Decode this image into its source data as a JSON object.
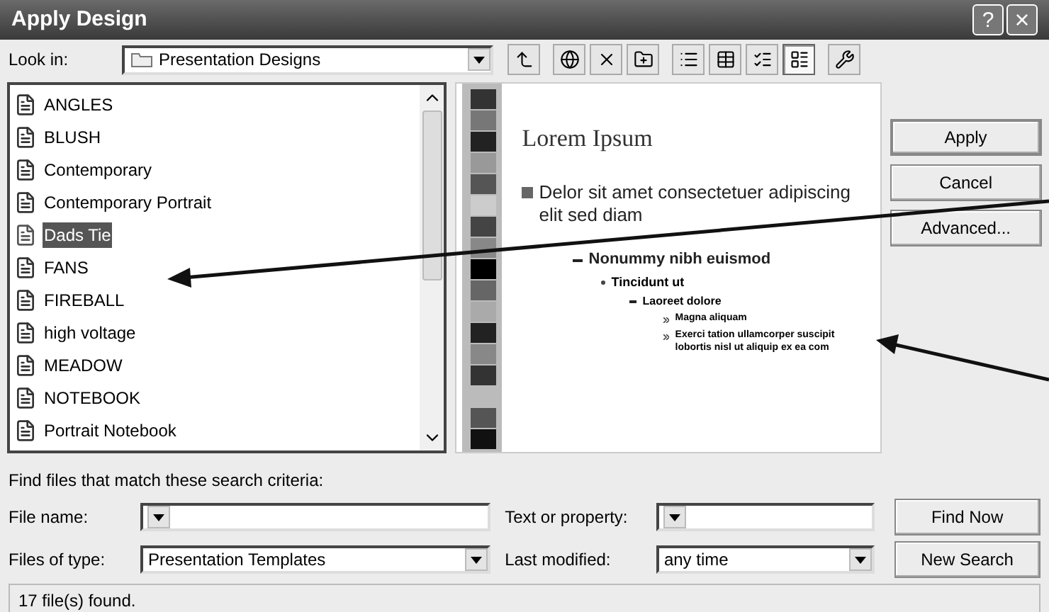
{
  "window": {
    "title": "Apply Design",
    "help_button": "?",
    "close_button": "×"
  },
  "look_in": {
    "label": "Look in:",
    "value": "Presentation Designs"
  },
  "toolbar": [
    {
      "kind": "up",
      "selected": false
    },
    {
      "kind": "web",
      "selected": false
    },
    {
      "kind": "delete",
      "selected": false
    },
    {
      "kind": "newfolder",
      "selected": false
    },
    {
      "kind": "list",
      "selected": false
    },
    {
      "kind": "details",
      "selected": false
    },
    {
      "kind": "properties",
      "selected": false
    },
    {
      "kind": "preview",
      "selected": true
    },
    {
      "kind": "tools",
      "selected": false
    }
  ],
  "files": [
    {
      "name": "ANGLES",
      "selected": false
    },
    {
      "name": "BLUSH",
      "selected": false
    },
    {
      "name": "Contemporary",
      "selected": false
    },
    {
      "name": "Contemporary Portrait",
      "selected": false
    },
    {
      "name": "Dads Tie",
      "selected": true
    },
    {
      "name": "FANS",
      "selected": false
    },
    {
      "name": "FIREBALL",
      "selected": false
    },
    {
      "name": "high voltage",
      "selected": false
    },
    {
      "name": "MEADOW",
      "selected": false
    },
    {
      "name": "NOTEBOOK",
      "selected": false
    },
    {
      "name": "Portrait Notebook",
      "selected": false
    }
  ],
  "preview": {
    "title": "Lorem Ipsum",
    "bullets": [
      {
        "text": "Delor sit amet consectetuer adipiscing elit sed diam",
        "children": [
          {
            "text": "Nonummy nibh euismod",
            "children": [
              {
                "text": "Tincidunt ut",
                "children": [
                  {
                    "text": "Laoreet dolore",
                    "children": [
                      {
                        "text": "Magna aliquam"
                      },
                      {
                        "text": "Exerci tation ullamcorper suscipit lobortis nisl ut aliquip ex ea com"
                      }
                    ]
                  }
                ]
              }
            ]
          }
        ]
      }
    ]
  },
  "buttons": [
    "Apply",
    "Cancel",
    "Advanced..."
  ],
  "search": {
    "heading": "Find files that match these search criteria:",
    "file_name": {
      "label": "File name:"
    },
    "text_or_property": {
      "label": "Text or property:"
    },
    "files_of_type": {
      "label": "Files of type:",
      "value": "Presentation Templates"
    },
    "last_modified": {
      "label": "Last modified:",
      "value": "any time"
    },
    "find_now": "Find Now",
    "new_search": "New Search"
  },
  "status_bar": "17 file(s) found."
}
